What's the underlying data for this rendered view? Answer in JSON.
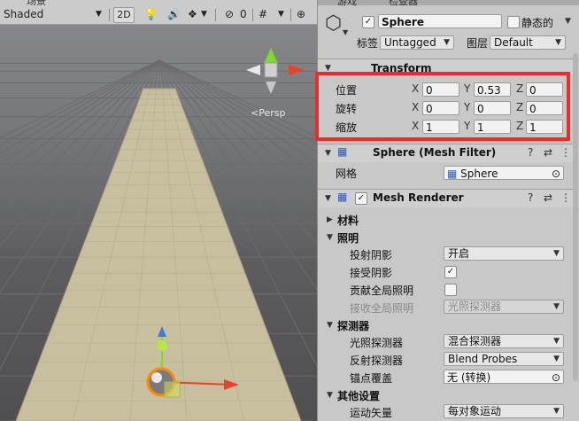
{
  "scene": {
    "tab_partial": "场景",
    "shading_mode": "Shaded",
    "mode_2d": "2D",
    "hidden_count": "0",
    "persp_label": "<Persp"
  },
  "inspector": {
    "tab_partial_1": "游戏",
    "tab_partial_2": "检查器",
    "object_name": "Sphere",
    "active": true,
    "static_label": "静态的",
    "tag_label": "标签",
    "tag_value": "Untagged",
    "layer_label": "图层",
    "layer_value": "Default",
    "transform": {
      "title": "Transform",
      "position_label": "位置",
      "rotation_label": "旋转",
      "scale_label": "缩放",
      "x": "X",
      "y": "Y",
      "z": "Z",
      "position": {
        "x": "0",
        "y": "0.53",
        "z": "0"
      },
      "rotation": {
        "x": "0",
        "y": "0",
        "z": "0"
      },
      "scale": {
        "x": "1",
        "y": "1",
        "z": "1"
      }
    },
    "mesh_filter": {
      "title": "Sphere (Mesh Filter)",
      "mesh_label": "网格",
      "mesh_value": "Sphere"
    },
    "mesh_renderer": {
      "title": "Mesh Renderer",
      "materials": "材料",
      "lighting": "照明",
      "cast_shadows_label": "投射阴影",
      "cast_shadows_value": "开启",
      "receive_shadows_label": "接受阴影",
      "receive_shadows": true,
      "contribute_gi_label": "贡献全局照明",
      "receive_gi_label": "接收全局照明",
      "receive_gi_value": "光照探测器",
      "probes": "探测器",
      "light_probes_label": "光照探测器",
      "light_probes_value": "混合探测器",
      "reflection_probes_label": "反射探测器",
      "reflection_probes_value": "Blend Probes",
      "anchor_override_label": "锚点覆盖",
      "anchor_override_value": "无 (转换)",
      "additional_settings": "其他设置",
      "motion_vectors_label": "运动矢量",
      "motion_vectors_value": "每对象运动"
    }
  },
  "colors": {
    "highlight": "#ef2a2a",
    "gizmo_y": "#7ddc2a",
    "gizmo_x": "#e8432a",
    "gizmo_z": "#3d7be0"
  }
}
